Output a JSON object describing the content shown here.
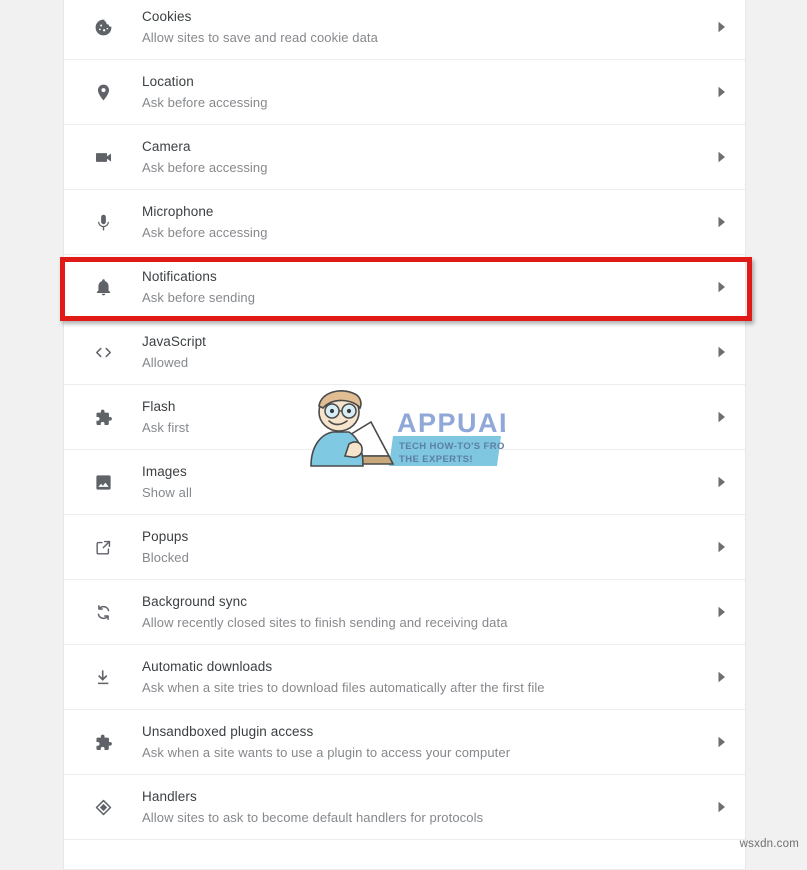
{
  "page": {
    "context": "chrome-site-settings-content",
    "background_color": "#f1f1f1",
    "card_color": "#ffffff",
    "title_color": "#3c4043",
    "subtitle_color": "#85888c",
    "icon_color": "#5f6368",
    "divider_color": "#ededed"
  },
  "highlight": {
    "target": "Notifications",
    "color": "#e01b17",
    "border_width_px": 5
  },
  "settings_list": [
    {
      "icon": "cookie-icon",
      "title": "Cookies",
      "subtitle": "Allow sites to save and read cookie data",
      "chevron": "chevron-right-icon"
    },
    {
      "icon": "location-pin-icon",
      "title": "Location",
      "subtitle": "Ask before accessing",
      "chevron": "chevron-right-icon"
    },
    {
      "icon": "camera-icon",
      "title": "Camera",
      "subtitle": "Ask before accessing",
      "chevron": "chevron-right-icon"
    },
    {
      "icon": "microphone-icon",
      "title": "Microphone",
      "subtitle": "Ask before accessing",
      "chevron": "chevron-right-icon"
    },
    {
      "icon": "bell-icon",
      "title": "Notifications",
      "subtitle": "Ask before sending",
      "chevron": "chevron-right-icon"
    },
    {
      "icon": "code-brackets-icon",
      "title": "JavaScript",
      "subtitle": "Allowed",
      "chevron": "chevron-right-icon"
    },
    {
      "icon": "puzzle-piece-icon",
      "title": "Flash",
      "subtitle": "Ask first",
      "chevron": "chevron-right-icon"
    },
    {
      "icon": "image-icon",
      "title": "Images",
      "subtitle": "Show all",
      "chevron": "chevron-right-icon"
    },
    {
      "icon": "popup-window-icon",
      "title": "Popups",
      "subtitle": "Blocked",
      "chevron": "chevron-right-icon"
    },
    {
      "icon": "sync-arrows-icon",
      "title": "Background sync",
      "subtitle": "Allow recently closed sites to finish sending and receiving data",
      "chevron": "chevron-right-icon"
    },
    {
      "icon": "download-icon",
      "title": "Automatic downloads",
      "subtitle": "Ask when a site tries to download files automatically after the first file",
      "chevron": "chevron-right-icon"
    },
    {
      "icon": "puzzle-piece-icon",
      "title": "Unsandboxed plugin access",
      "subtitle": "Ask when a site wants to use a plugin to access your computer",
      "chevron": "chevron-right-icon"
    },
    {
      "icon": "handlers-diamond-icon",
      "title": "Handlers",
      "subtitle": "Allow sites to ask to become default handlers for protocols",
      "chevron": "chevron-right-icon"
    }
  ],
  "watermark": {
    "brand": "APPUALS",
    "tagline_line1": "TECH HOW-TO'S FROM",
    "tagline_line2": "THE EXPERTS!",
    "brand_color": "#8fa8d8",
    "banner_color": "#7fc6e0"
  },
  "footer": {
    "url": "wsxdn.com"
  }
}
